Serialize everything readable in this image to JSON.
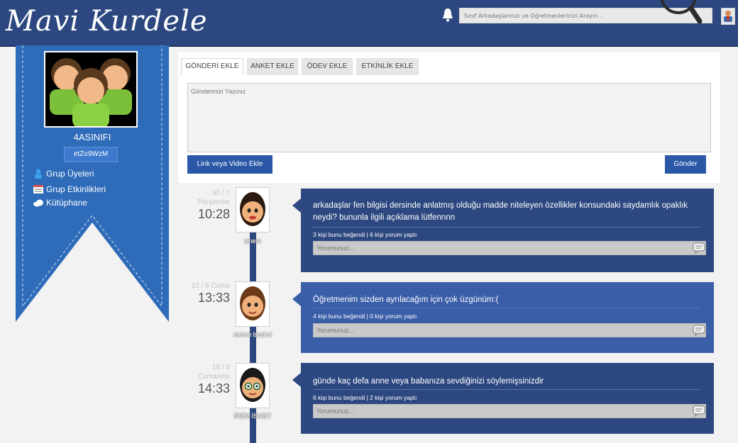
{
  "header": {
    "logo": "Mavi Kurdele",
    "search_placeholder": "Sınıf Arkadaşlarınızı ve Öğretmenlerinizi Arayın..."
  },
  "sidebar": {
    "group_name": "4ASINIFI",
    "group_code": "etZo9WzM",
    "items": [
      {
        "label": "Grup Üyeleri",
        "icon": "user-icon"
      },
      {
        "label": "Grup Etkinlikleri",
        "icon": "calendar-icon"
      },
      {
        "label": "Kütüphane",
        "icon": "cloud-icon"
      }
    ]
  },
  "compose": {
    "tabs": [
      "GÖNDERİ EKLE",
      "ANKET EKLE",
      "ÖDEV EKLE",
      "ETKİNLİK EKLE"
    ],
    "placeholder": "Gönderinizi Yazınız",
    "link_button": "Link veya Video Ekle",
    "send_button": "Gönder"
  },
  "posts": [
    {
      "date": "30 / 7",
      "day": "Perşembe",
      "time": "10:28",
      "user": "sinem",
      "text": "arkadaşlar fen bilgisi dersinde anlatmış olduğu madde niteleyen özellikler konsundaki saydamlık opaklık neydi? bununla ilgili açıklama lütfennnn",
      "stats": "3 kişi bunu beğendi | 6 kişi yorum yaptı",
      "comment_placeholder": "Yorumunuz..."
    },
    {
      "date": "12 / 6 Cuma",
      "day": "",
      "time": "13:33",
      "user": "merve bezirci",
      "text": "Öğretmenim sizden ayrılacağım için çok üzgünüm:(",
      "stats": "4 kişi bunu beğendi | 0 kişi yorum yaptı",
      "comment_placeholder": "Yorumunuz..."
    },
    {
      "date": "16 / 5",
      "day": "Cumartesi",
      "time": "14:33",
      "user": "İREM İSMET",
      "text": "günde kaç defa anne veya babanıza sevdiğinizi söylemişsinizdir",
      "stats": "6 kişi bunu beğendi | 2 kişi yorum yaptı",
      "comment_placeholder": "Yorumunuz..."
    }
  ],
  "colors": {
    "header": "#2d4880",
    "ribbon": "#2e6bb8",
    "post_card": "#2d4880",
    "button": "#2a57a6"
  }
}
